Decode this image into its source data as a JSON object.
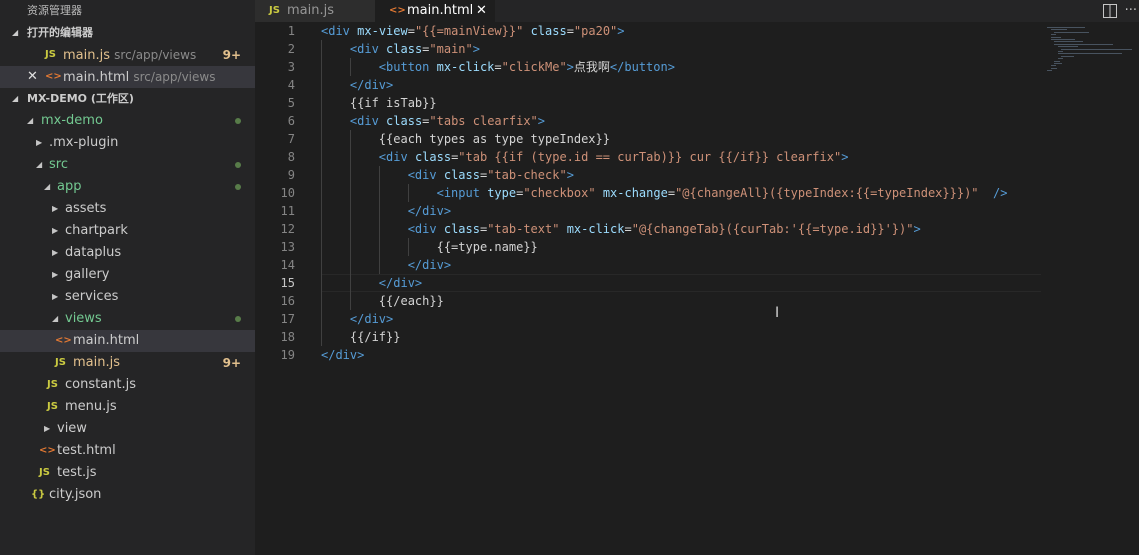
{
  "sidebar": {
    "title": "资源管理器",
    "open_editors": {
      "title": "打开的编辑器",
      "items": [
        {
          "icon": "JS",
          "name": "main.js",
          "path": "src/app/views",
          "badge": "9+"
        },
        {
          "icon": "<>",
          "name": "main.html",
          "path": "src/app/views",
          "close": "✕"
        }
      ]
    },
    "workspace": {
      "title": "MX-DEMO (工作区)",
      "items": [
        {
          "label": "mx-demo"
        },
        {
          "label": ".mx-plugin"
        },
        {
          "label": "src"
        },
        {
          "label": "app"
        },
        {
          "label": "assets"
        },
        {
          "label": "chartpark"
        },
        {
          "label": "dataplus"
        },
        {
          "label": "gallery"
        },
        {
          "label": "services"
        },
        {
          "label": "views"
        },
        {
          "label": "main.html",
          "icon": "<>"
        },
        {
          "label": "main.js",
          "icon": "JS",
          "badge": "9+"
        },
        {
          "label": "constant.js",
          "icon": "JS"
        },
        {
          "label": "menu.js",
          "icon": "JS"
        },
        {
          "label": "view"
        },
        {
          "label": "test.html",
          "icon": "<>"
        },
        {
          "label": "test.js",
          "icon": "JS"
        },
        {
          "label": "city.json",
          "icon": "{}"
        }
      ]
    }
  },
  "tabs": [
    {
      "icon": "JS",
      "label": "main.js"
    },
    {
      "icon": "<>",
      "label": "main.html",
      "close": "✕"
    }
  ],
  "editor": {
    "line_numbers": [
      "1",
      "2",
      "3",
      "4",
      "5",
      "6",
      "7",
      "8",
      "9",
      "10",
      "11",
      "12",
      "13",
      "14",
      "15",
      "16",
      "17",
      "18",
      "19"
    ],
    "lines": [
      [
        [
          "tag",
          "<div"
        ],
        [
          "txt",
          " "
        ],
        [
          "attr",
          "mx-view"
        ],
        [
          "txt",
          "="
        ],
        [
          "str",
          "\"{{=mainView}}\""
        ],
        [
          "txt",
          " "
        ],
        [
          "attr",
          "class"
        ],
        [
          "txt",
          "="
        ],
        [
          "str",
          "\"pa20\""
        ],
        [
          "tag",
          ">"
        ]
      ],
      [
        [
          "txt",
          "    "
        ],
        [
          "tag",
          "<div"
        ],
        [
          "txt",
          " "
        ],
        [
          "attr",
          "class"
        ],
        [
          "txt",
          "="
        ],
        [
          "str",
          "\"main\""
        ],
        [
          "tag",
          ">"
        ]
      ],
      [
        [
          "txt",
          "        "
        ],
        [
          "tag",
          "<button"
        ],
        [
          "txt",
          " "
        ],
        [
          "attr",
          "mx-click"
        ],
        [
          "txt",
          "="
        ],
        [
          "str",
          "\"clickMe\""
        ],
        [
          "tag",
          ">"
        ],
        [
          "txt",
          "点我啊"
        ],
        [
          "tag",
          "</button>"
        ]
      ],
      [
        [
          "txt",
          "    "
        ],
        [
          "tag",
          "</div>"
        ]
      ],
      [
        [
          "txt",
          "    {{if isTab}}"
        ]
      ],
      [
        [
          "txt",
          "    "
        ],
        [
          "tag",
          "<div"
        ],
        [
          "txt",
          " "
        ],
        [
          "attr",
          "class"
        ],
        [
          "txt",
          "="
        ],
        [
          "str",
          "\"tabs clearfix\""
        ],
        [
          "tag",
          ">"
        ]
      ],
      [
        [
          "txt",
          "        {{each types as type typeIndex}}"
        ]
      ],
      [
        [
          "txt",
          "        "
        ],
        [
          "tag",
          "<div"
        ],
        [
          "txt",
          " "
        ],
        [
          "attr",
          "class"
        ],
        [
          "txt",
          "="
        ],
        [
          "str",
          "\"tab {{if (type.id == curTab)}} cur {{/if}} clearfix\""
        ],
        [
          "tag",
          ">"
        ]
      ],
      [
        [
          "txt",
          "            "
        ],
        [
          "tag",
          "<div"
        ],
        [
          "txt",
          " "
        ],
        [
          "attr",
          "class"
        ],
        [
          "txt",
          "="
        ],
        [
          "str",
          "\"tab-check\""
        ],
        [
          "tag",
          ">"
        ]
      ],
      [
        [
          "txt",
          "                "
        ],
        [
          "tag",
          "<input"
        ],
        [
          "txt",
          " "
        ],
        [
          "attr",
          "type"
        ],
        [
          "txt",
          "="
        ],
        [
          "str",
          "\"checkbox\""
        ],
        [
          "txt",
          " "
        ],
        [
          "attr",
          "mx-change"
        ],
        [
          "txt",
          "="
        ],
        [
          "str",
          "\"@{changeAll}({typeIndex:{{=typeIndex}}})\""
        ],
        [
          "txt",
          "  "
        ],
        [
          "tag",
          "/>"
        ]
      ],
      [
        [
          "txt",
          "            "
        ],
        [
          "tag",
          "</div>"
        ]
      ],
      [
        [
          "txt",
          "            "
        ],
        [
          "tag",
          "<div"
        ],
        [
          "txt",
          " "
        ],
        [
          "attr",
          "class"
        ],
        [
          "txt",
          "="
        ],
        [
          "str",
          "\"tab-text\""
        ],
        [
          "txt",
          " "
        ],
        [
          "attr",
          "mx-click"
        ],
        [
          "txt",
          "="
        ],
        [
          "str",
          "\"@{changeTab}({curTab:'{{=type.id}}'})\""
        ],
        [
          "tag",
          ">"
        ]
      ],
      [
        [
          "txt",
          "                {{=type.name}}"
        ]
      ],
      [
        [
          "txt",
          "            "
        ],
        [
          "tag",
          "</div>"
        ]
      ],
      [
        [
          "txt",
          "        "
        ],
        [
          "tag",
          "</div>"
        ]
      ],
      [
        [
          "txt",
          "        {{/each}}"
        ]
      ],
      [
        [
          "txt",
          "    "
        ],
        [
          "tag",
          "</div>"
        ]
      ],
      [
        [
          "txt",
          "    {{/if}}"
        ]
      ],
      [
        [
          "tag",
          "</div>"
        ]
      ]
    ],
    "active_line": 15
  },
  "colors": {
    "js": "#cbcb41",
    "html": "#e37933",
    "modified": "#73c991",
    "badge": "#e2c08d"
  }
}
